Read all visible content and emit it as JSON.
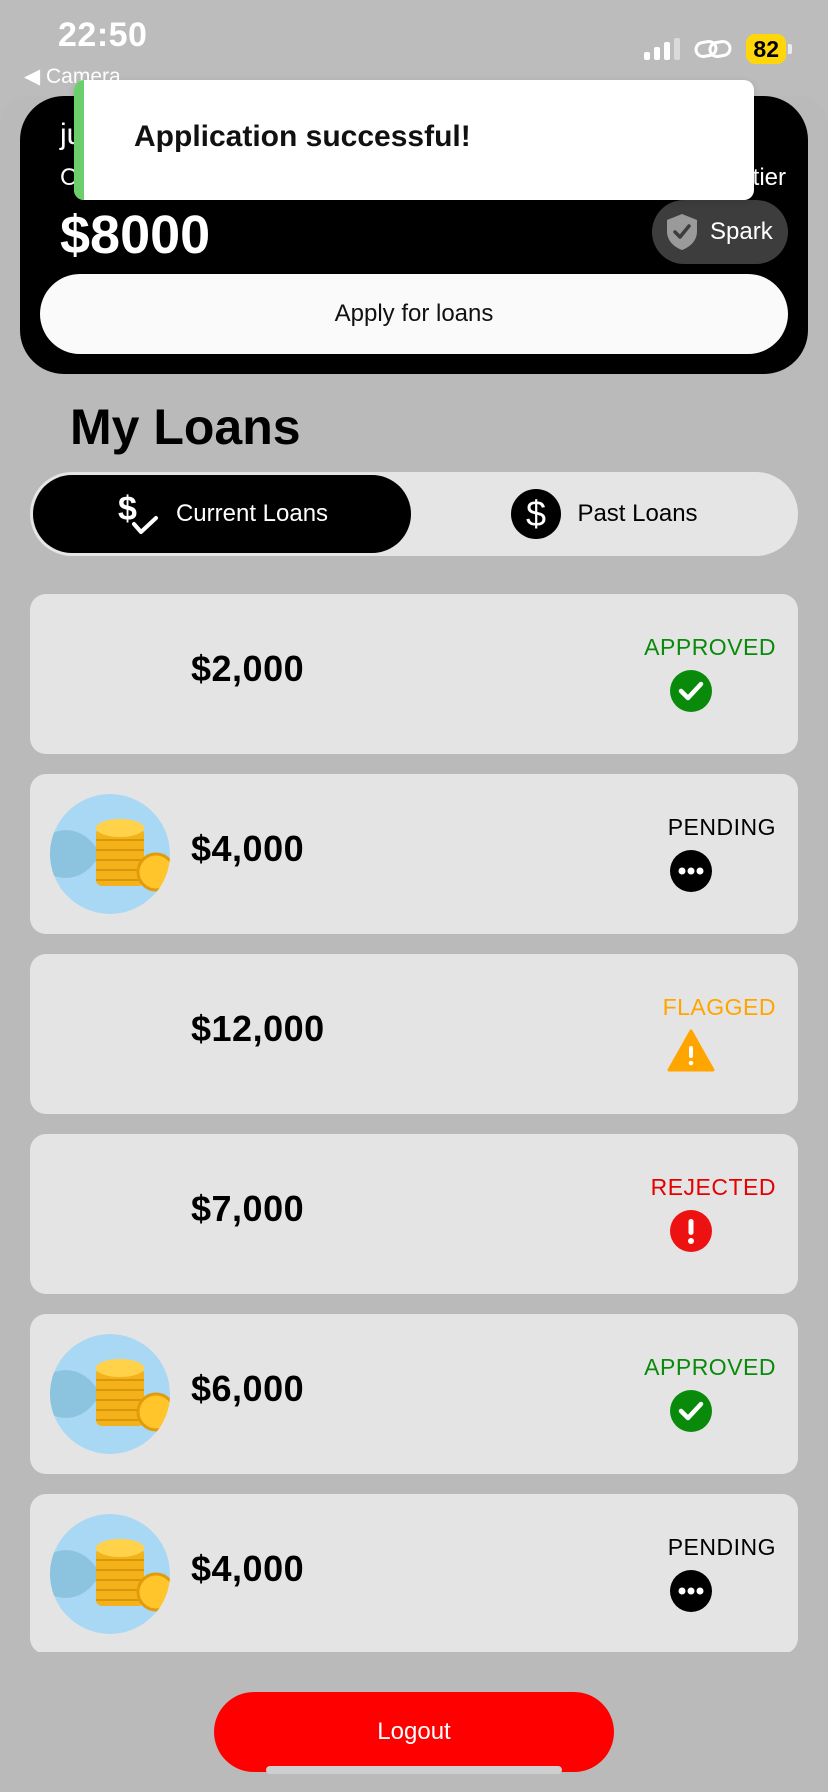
{
  "status_bar": {
    "time": "22:50",
    "back_label": "◀ Camera",
    "battery": "82",
    "icons": [
      "signal-icon",
      "link-icon",
      "battery-icon"
    ]
  },
  "header": {
    "user_name": "juc",
    "credit_label": "Cur",
    "tier_label": "tier",
    "credit_amount": "$8000",
    "tier_name": "Spark",
    "apply_label": "Apply for loans"
  },
  "toast": {
    "message": "Application successful!",
    "accent_color": "#6bcf6b"
  },
  "loans_section": {
    "title": "My Loans",
    "tabs": [
      {
        "label": "Current Loans",
        "icon": "dollar-check-icon",
        "selected": true
      },
      {
        "label": "Past Loans",
        "icon": "dollar-circle-icon",
        "selected": false
      }
    ]
  },
  "loans": [
    {
      "amount": "$2,000",
      "status": "APPROVED",
      "status_color": "#0a8a0a",
      "icon": "check-circle-icon",
      "has_image": false
    },
    {
      "amount": "$4,000",
      "status": "PENDING",
      "status_color": "#000000",
      "icon": "ellipsis-circle-icon",
      "has_image": true
    },
    {
      "amount": "$12,000",
      "status": "FLAGGED",
      "status_color": "#ffa500",
      "icon": "warning-triangle-icon",
      "has_image": false
    },
    {
      "amount": "$7,000",
      "status": "REJECTED",
      "status_color": "#e60000",
      "icon": "exclamation-circle-icon",
      "has_image": false
    },
    {
      "amount": "$6,000",
      "status": "APPROVED",
      "status_color": "#0a8a0a",
      "icon": "check-circle-icon",
      "has_image": true
    },
    {
      "amount": "$4,000",
      "status": "PENDING",
      "status_color": "#000000",
      "icon": "ellipsis-circle-icon",
      "has_image": true
    }
  ],
  "logout_label": "Logout",
  "colors": {
    "background": "#bcbcbc",
    "card": "#e4e4e4",
    "logout": "#ff0000"
  }
}
